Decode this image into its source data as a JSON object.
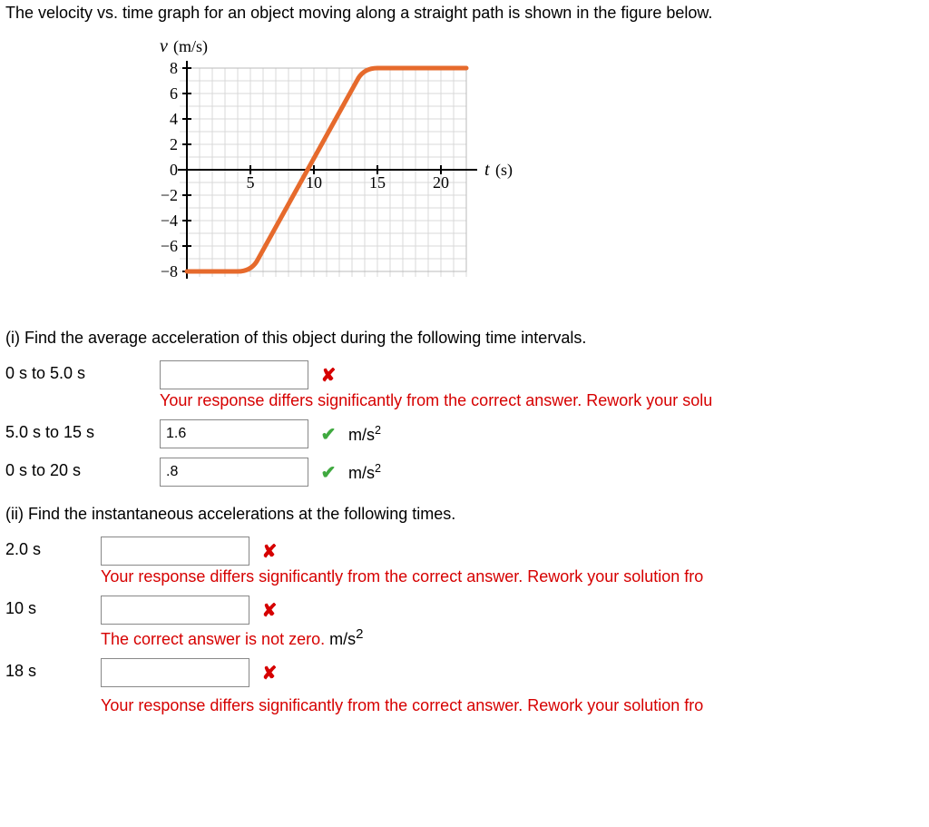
{
  "prompt": "The velocity vs. time graph for an object moving along a straight path is shown in the figure below.",
  "axis_y": "v (m/s)",
  "axis_x": "t (s)",
  "part_i": "(i) Find the average acceleration of this object during the following time intervals.",
  "part_ii": "(ii) Find the instantaneous accelerations at the following times.",
  "feedback_differs": "Your response differs significantly from the correct answer. Rework your solu",
  "feedback_differs2": "Your response differs significantly from the correct answer. Rework your solution fro",
  "feedback_notzero_pre": "The correct answer is not zero. ",
  "feedback_cutoff": "Your response differs significantly from the correct answer. Rework your solution fro",
  "unit": "m/s",
  "i1": {
    "label": "0 s to 5.0 s",
    "value": ""
  },
  "i2": {
    "label": "5.0 s to 15 s",
    "value": "1.6"
  },
  "i3": {
    "label": "0 s to 20 s",
    "value": ".8"
  },
  "ii1": {
    "label": "2.0 s",
    "value": ""
  },
  "ii2": {
    "label": "10 s",
    "value": ""
  },
  "ii3": {
    "label": "18 s",
    "value": ""
  },
  "chart_data": {
    "type": "line",
    "title": "",
    "xlabel": "t (s)",
    "ylabel": "v (m/s)",
    "xlim": [
      0,
      22
    ],
    "ylim": [
      -8,
      9
    ],
    "x_ticks": [
      5,
      10,
      15,
      20
    ],
    "y_ticks": [
      -8,
      -6,
      -4,
      -2,
      0,
      2,
      4,
      6,
      8
    ],
    "series": [
      {
        "name": "velocity",
        "color": "#e66a2c",
        "x": [
          0,
          4,
          5,
          14,
          15,
          22
        ],
        "y": [
          -8,
          -8,
          -7.5,
          7.5,
          8,
          8
        ]
      }
    ]
  }
}
